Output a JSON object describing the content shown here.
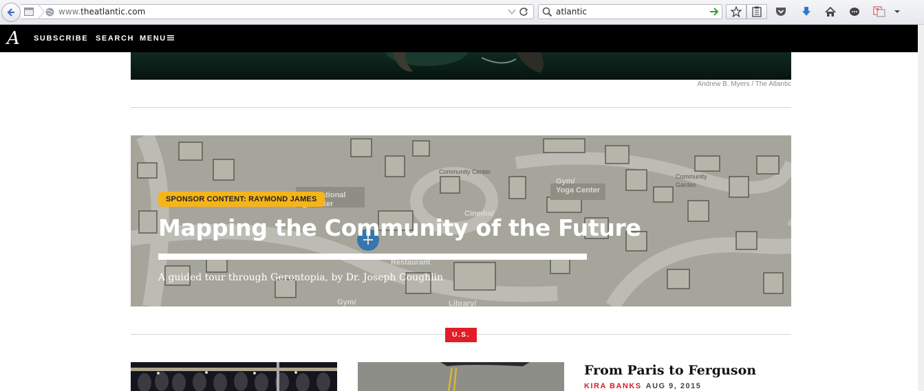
{
  "browser": {
    "url_prefix": "www.",
    "url_domain": "theatlantic.com",
    "search_value": "atlantic",
    "icons": [
      "back-icon",
      "page-icon",
      "globe-icon",
      "dropdown-icon",
      "reload-icon",
      "search-icon",
      "go-arrow-icon",
      "bookmark-star-icon",
      "reading-list-icon",
      "pocket-icon",
      "downloads-icon",
      "home-icon",
      "chat-icon",
      "translate-icon",
      "menu-arrow-icon"
    ]
  },
  "site": {
    "logo": "A",
    "nav": {
      "subscribe": "SUBSCRIBE",
      "search": "SEARCH",
      "menu": "MENU"
    }
  },
  "hero": {
    "photo_credit": "Andrew B. Myers / The Atlantic"
  },
  "sponsor": {
    "badge": "SPONSOR CONTENT: RAYMOND JAMES",
    "title": "Mapping the Community of the Future",
    "subtitle": "A guided tour through Gerontopia, by Dr. Joseph Coughlin",
    "map_labels": {
      "generational": "al/Generational",
      "center_left": "ng Center",
      "community_center": "Community Center",
      "gym_yoga_1": "Gym/",
      "gym_yoga_2": "Yoga Center",
      "community_garden_1": "Community",
      "community_garden_2": "Garden",
      "cinema": "Cinema/",
      "restaurant": "Restaurant",
      "gym_bottom": "Gym/",
      "library": "Library/"
    }
  },
  "section": {
    "tag": "U.S."
  },
  "story": {
    "title": "From Paris to Ferguson",
    "author": "KIRA BANKS",
    "date": "AUG 9, 2015"
  },
  "colors": {
    "nav_bg": "#000000",
    "sponsor_badge": "#f5b41a",
    "section_tag": "#e21d28",
    "author": "#d22128"
  }
}
